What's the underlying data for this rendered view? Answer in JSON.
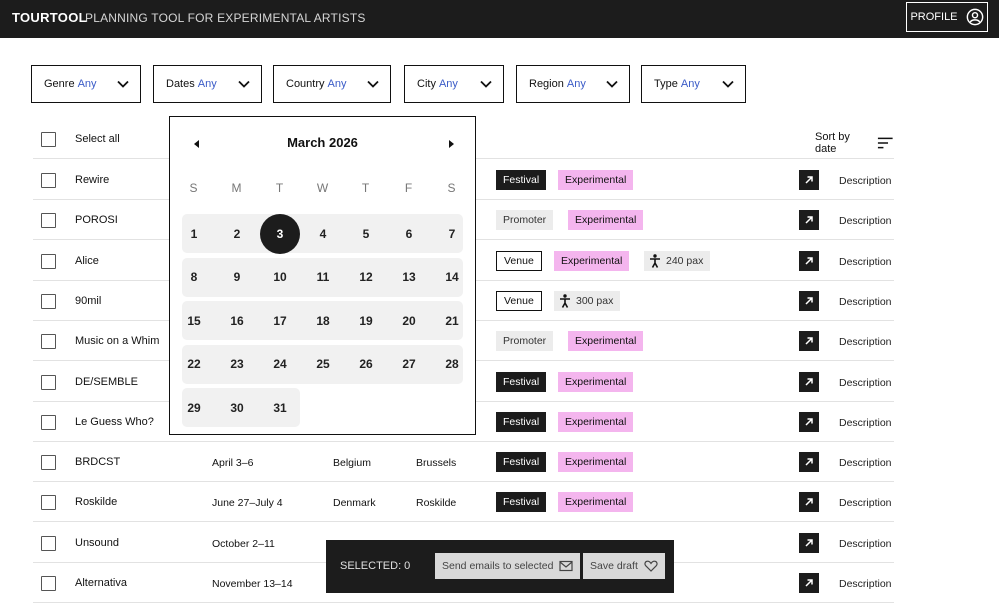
{
  "app": {
    "logo": "TOURTOOL",
    "tagline": "PLANNING TOOL FOR EXPERIMENTAL ARTISTS",
    "profile_label": "PROFILE"
  },
  "filters": [
    {
      "label": "Genre",
      "value": "Any"
    },
    {
      "label": "Dates",
      "value": "Any"
    },
    {
      "label": "Country",
      "value": "Any"
    },
    {
      "label": "City",
      "value": "Any"
    },
    {
      "label": "Region",
      "value": "Any"
    },
    {
      "label": "Type",
      "value": "Any"
    }
  ],
  "table": {
    "select_all_label": "Select all",
    "sort_label": "Sort by date",
    "description_label": "Description",
    "rows": [
      {
        "name": "Rewire",
        "date": "",
        "country": "",
        "city": "",
        "type": "Festival",
        "genre": "Experimental",
        "pax": ""
      },
      {
        "name": "POROSI",
        "date": "",
        "country": "",
        "city": "",
        "type": "Promoter",
        "genre": "Experimental",
        "pax": ""
      },
      {
        "name": "Alice",
        "date": "",
        "country": "",
        "city": "",
        "type": "Venue",
        "genre": "Experimental",
        "pax": "240 pax"
      },
      {
        "name": "90mil",
        "date": "",
        "country": "",
        "city": "",
        "type": "Venue",
        "genre": "",
        "pax": "300 pax"
      },
      {
        "name": "Music on a Whim",
        "date": "",
        "country": "",
        "city": "",
        "type": "Promoter",
        "genre": "Experimental",
        "pax": ""
      },
      {
        "name": "DE/SEMBLE",
        "date": "",
        "country": "",
        "city": "",
        "type": "Festival",
        "genre": "Experimental",
        "pax": ""
      },
      {
        "name": "Le Guess Who?",
        "date": "",
        "country": "",
        "city": "",
        "type": "Festival",
        "genre": "Experimental",
        "pax": ""
      },
      {
        "name": "BRDCST",
        "date": "April 3–6",
        "country": "Belgium",
        "city": "Brussels",
        "type": "Festival",
        "genre": "Experimental",
        "pax": ""
      },
      {
        "name": "Roskilde",
        "date": "June 27–July 4",
        "country": "Denmark",
        "city": "Roskilde",
        "type": "Festival",
        "genre": "Experimental",
        "pax": ""
      },
      {
        "name": "Unsound",
        "date": "October 2–11",
        "country": "",
        "city": "",
        "type": "",
        "genre": "",
        "pax": ""
      },
      {
        "name": "Alternativa",
        "date": "November 13–14",
        "country": "",
        "city": "",
        "type": "",
        "genre": "",
        "pax": ""
      }
    ]
  },
  "calendar": {
    "month_label": "March 2026",
    "weekdays": [
      "S",
      "M",
      "T",
      "W",
      "T",
      "F",
      "S"
    ],
    "weeks": [
      [
        "1",
        "2",
        "3",
        "4",
        "5",
        "6",
        "7"
      ],
      [
        "8",
        "9",
        "10",
        "11",
        "12",
        "13",
        "14"
      ],
      [
        "15",
        "16",
        "17",
        "18",
        "19",
        "20",
        "21"
      ],
      [
        "22",
        "23",
        "24",
        "25",
        "26",
        "27",
        "28"
      ],
      [
        "29",
        "30",
        "31"
      ]
    ],
    "selected_day": "3"
  },
  "selection_bar": {
    "count_label": "SELECTED: 0",
    "send_label": "Send emails to selected",
    "draft_label": "Save draft"
  },
  "colors": {
    "dark": "#1c1c1c",
    "pink_tag": "#f4b5ee",
    "filter_value": "#3a5bc7"
  }
}
